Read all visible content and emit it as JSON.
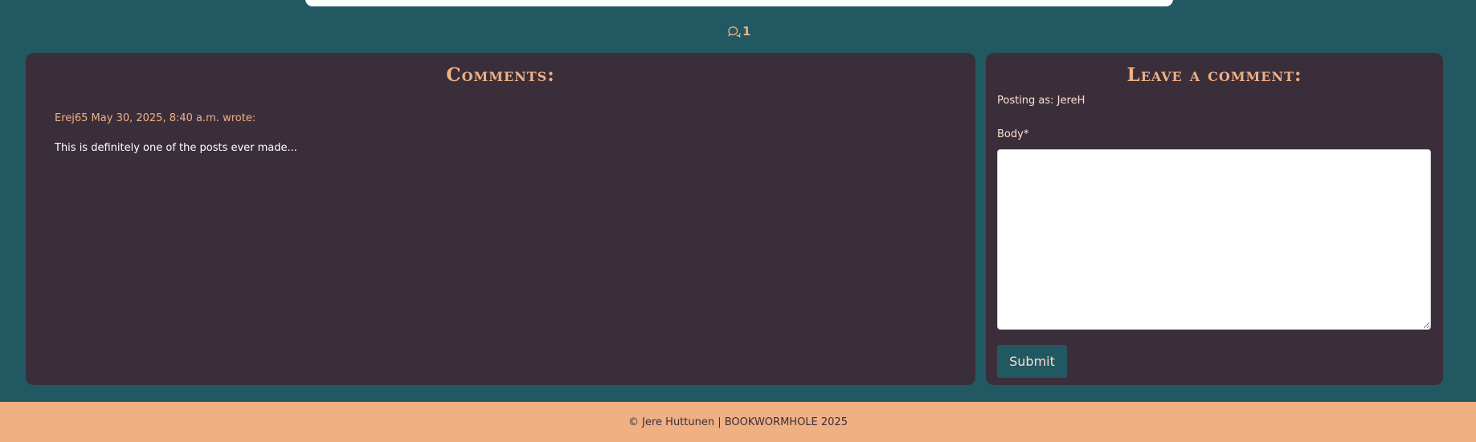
{
  "post": {
    "comment_count": "1",
    "comment_icon": "comments-icon"
  },
  "comments": {
    "title": "Comments:",
    "items": [
      {
        "meta": "Erej65 May 30, 2025, 8:40 a.m. wrote:",
        "body": "This is definitely one of the posts ever made..."
      }
    ]
  },
  "leave_comment": {
    "title": "Leave a comment:",
    "posting_as": "Posting as: JereH",
    "body_label": "Body*",
    "body_value": "",
    "submit_label": "Submit"
  },
  "footer": {
    "text": "© Jere Huttunen | BOOKWORMHOLE 2025"
  },
  "colors": {
    "background": "#225862",
    "panel": "#3b2e3b",
    "accent": "#efb084",
    "text_light": "#fbe0cf"
  }
}
